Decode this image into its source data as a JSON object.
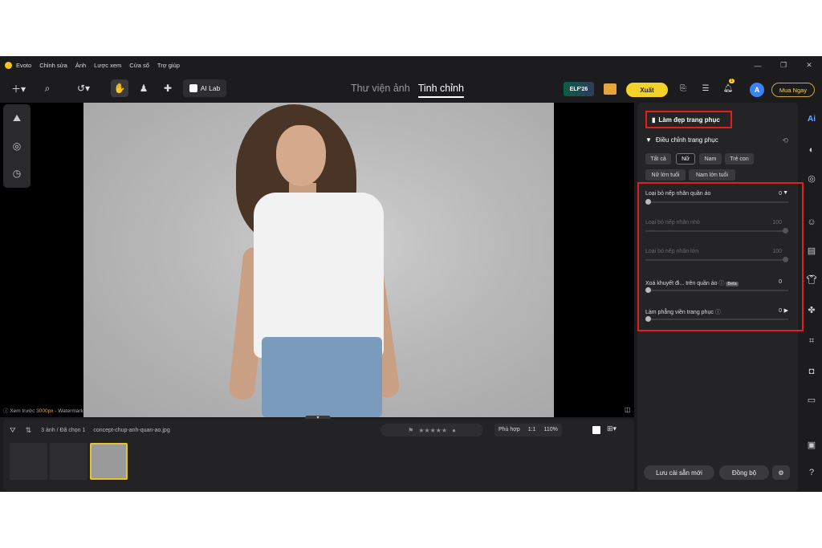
{
  "app": {
    "name": "Evoto",
    "menu": [
      "Chỉnh sửa",
      "Ảnh",
      "Lược xem",
      "Cửa sổ",
      "Trợ giúp"
    ]
  },
  "toolbar": {
    "ailab_label": "AI Lab",
    "mode_tabs": [
      {
        "label": "Thư viện ảnh",
        "active": false
      },
      {
        "label": "Tinh chỉnh",
        "active": true
      }
    ],
    "elf_badge": "ELF'26",
    "export_label": "Xuất",
    "notification_count": "1",
    "avatar_letter": "A",
    "buy_now_label": "Mua Ngay"
  },
  "canvas": {
    "watermark_prefix": "Xem trước",
    "watermark_size": "3000px",
    "watermark_suffix": "- Watermark chỉ hiển thị trong bản xem trước"
  },
  "filmstrip": {
    "count_text": "3 ảnh / Đã chọn 1",
    "filename": "concept-chup-anh-quan-ao.jpg",
    "fit_label": "Phù hợp",
    "ratio_label": "1:1",
    "zoom_label": "110%"
  },
  "panel": {
    "header_title": "Làm đẹp trang phục",
    "section_title": "Điều chỉnh trang phục",
    "chips": [
      {
        "label": "Tất cả",
        "selected": false
      },
      {
        "label": "Nữ",
        "selected": true
      },
      {
        "label": "Nam",
        "selected": false
      },
      {
        "label": "Trẻ con",
        "selected": false
      },
      {
        "label": "Nữ lớn tuổi",
        "selected": false
      },
      {
        "label": "Nam lớn tuổi",
        "selected": false
      }
    ],
    "sliders": [
      {
        "label": "Loại bỏ nếp nhăn quần áo",
        "value": "0",
        "level": 0,
        "enabled": true
      },
      {
        "label": "Loại bỏ nếp nhăn nhỏ",
        "value": "100",
        "level": 1,
        "enabled": false
      },
      {
        "label": "Loại bỏ nếp nhăn lớn",
        "value": "100",
        "level": 1,
        "enabled": false
      },
      {
        "label": "Xoá khuyết đi... trên quần áo",
        "value": "0",
        "level": 0,
        "enabled": true,
        "beta": "Beta"
      },
      {
        "label": "Làm phẳng viền trang phục",
        "value": "0",
        "level": 0,
        "enabled": true
      }
    ],
    "save_preset_label": "Lưu cài sẵn mới",
    "sync_label": "Đồng bộ"
  },
  "colors": {
    "accent_yellow": "#f5d22a",
    "highlight_red": "#e0201e",
    "panel_bg": "#242427",
    "app_bg": "#1c1c1e"
  }
}
